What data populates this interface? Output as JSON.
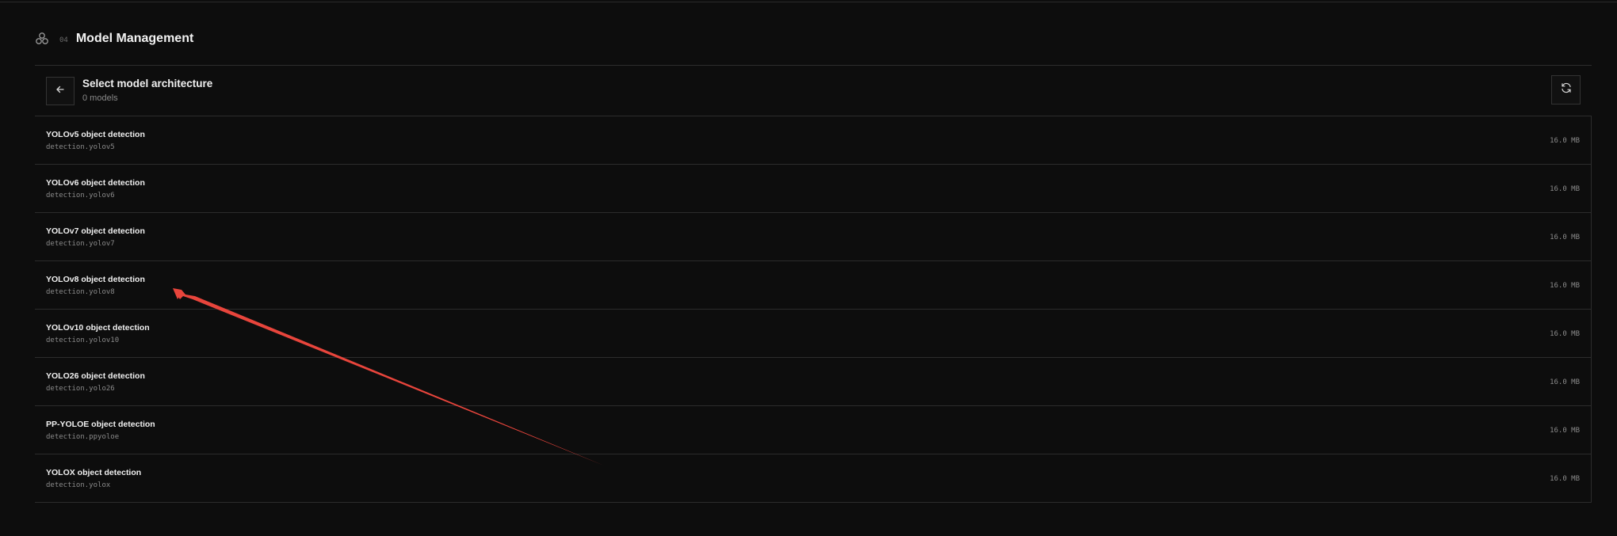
{
  "section": {
    "number": "04",
    "title": "Model Management",
    "icon": "stack-circles-icon"
  },
  "panel": {
    "title": "Select model architecture",
    "count_text": "0 models",
    "back_icon": "arrow-left-icon",
    "refresh_icon": "refresh-icon"
  },
  "models": [
    {
      "name": "YOLOv5 object detection",
      "id": "detection.yolov5",
      "size": "16.0 MB"
    },
    {
      "name": "YOLOv6 object detection",
      "id": "detection.yolov6",
      "size": "16.0 MB"
    },
    {
      "name": "YOLOv7 object detection",
      "id": "detection.yolov7",
      "size": "16.0 MB"
    },
    {
      "name": "YOLOv8 object detection",
      "id": "detection.yolov8",
      "size": "16.0 MB"
    },
    {
      "name": "YOLOv10 object detection",
      "id": "detection.yolov10",
      "size": "16.0 MB"
    },
    {
      "name": "YOLO26 object detection",
      "id": "detection.yolo26",
      "size": "16.0 MB"
    },
    {
      "name": "PP-YOLOE object detection",
      "id": "detection.ppyoloe",
      "size": "16.0 MB"
    },
    {
      "name": "YOLOX object detection",
      "id": "detection.yolox",
      "size": "16.0 MB"
    }
  ],
  "colors": {
    "background": "#0d0d0d",
    "border": "#2c2c2c",
    "annotation_arrow": "#e8453c"
  }
}
